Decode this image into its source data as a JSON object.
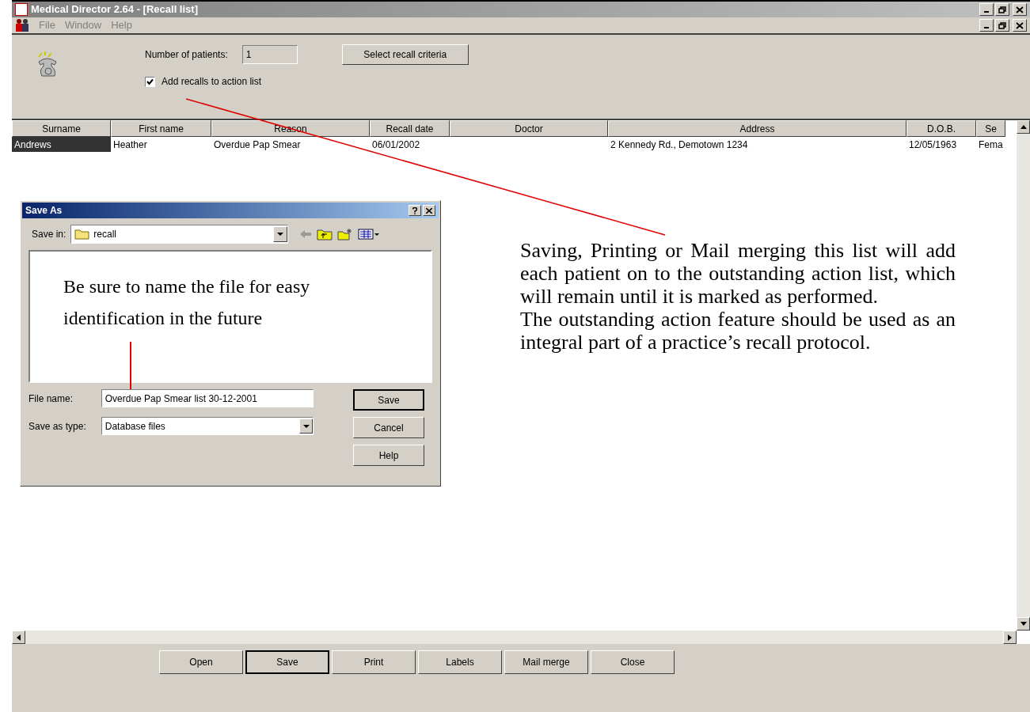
{
  "window": {
    "title": "Medical Director 2.64 - [Recall list]"
  },
  "menu": [
    "File",
    "Window",
    "Help"
  ],
  "top_panel": {
    "patients_label": "Number of patients:",
    "patients_value": "1",
    "criteria_button": "Select recall criteria",
    "checkbox": {
      "label": "Add recalls to action list",
      "checked": true
    }
  },
  "table": {
    "columns": [
      "Surname",
      "First name",
      "Reason",
      "Recall date",
      "Doctor",
      "Address",
      "D.O.B.",
      "Se"
    ],
    "rows": [
      {
        "cells": [
          {
            "text": "Andrews",
            "selected": true
          },
          {
            "text": "Heather",
            "selected": false
          },
          {
            "text": "Overdue Pap Smear",
            "selected": false
          },
          {
            "text": "06/01/2002",
            "selected": false
          },
          {
            "selected": false
          },
          {
            "text": "2 Kennedy Rd.,  Demotown  1234",
            "selected": false
          },
          {
            "text": "12/05/1963",
            "selected": false
          },
          {
            "text": "Fema",
            "selected": false
          }
        ]
      }
    ]
  },
  "dialog": {
    "title": "Save As",
    "save_in_label": "Save in:",
    "save_in_value": "recall",
    "note": "Be sure to name the file for easy identification in the future",
    "file_name_label": "File name:",
    "file_name_value": "Overdue Pap Smear list 30-12-2001",
    "type_label": "Save as type:",
    "type_value": "Database files",
    "buttons": [
      {
        "label": "Save",
        "default": true
      },
      {
        "label": "Cancel",
        "default": false
      },
      {
        "label": "Help",
        "default": false
      }
    ]
  },
  "annotation": [
    "Saving, Printing or Mail merging this list will add each patient on to the outstanding action list, which will remain until it is marked as performed.",
    "The outstanding action feature should be used as an integral part of a practice’s recall protocol."
  ],
  "buttons": [
    {
      "label": "Open",
      "default": false
    },
    {
      "label": "Save",
      "default": true
    },
    {
      "label": "Print",
      "default": false
    },
    {
      "label": "Labels",
      "default": false
    },
    {
      "label": "Mail merge",
      "default": false
    },
    {
      "label": "Close",
      "default": false
    }
  ]
}
